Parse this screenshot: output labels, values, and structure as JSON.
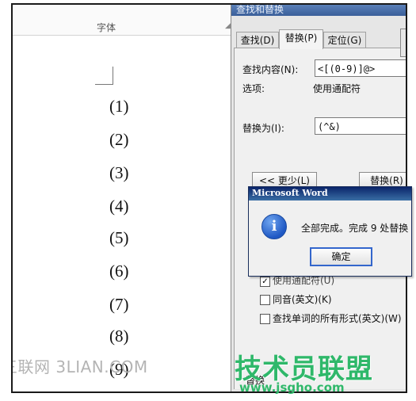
{
  "ribbon": {
    "font_group_label": "字体",
    "launcher_icon": "dialog-launcher-icon"
  },
  "document": {
    "numbers": [
      "(1)",
      "(2)",
      "(3)",
      "(4)",
      "(5)",
      "(6)",
      "(7)",
      "(8)",
      "(9)"
    ]
  },
  "watermark_left": "三联网 3LIAN.COM",
  "find_replace": {
    "title": "查找和替换",
    "tabs": [
      {
        "label": "查找(D)"
      },
      {
        "label": "替换(P)",
        "active": true
      },
      {
        "label": "定位(G)"
      }
    ],
    "find_label": "查找内容(N):",
    "find_value": "<[(0-9)]@>",
    "options_label": "选项:",
    "options_value": "使用通配符",
    "replace_label": "替换为(I):",
    "replace_value": "(^&)",
    "less_button": "<< 更少(L)",
    "replace_button": "替换(R)",
    "search_options_partial": "搜",
    "checkboxes": [
      {
        "label": "使用通配符(U)",
        "checked": true
      },
      {
        "label": "同音(英文)(K)",
        "checked": false
      },
      {
        "label": "查找单词的所有形式(英文)(W)",
        "checked": false
      }
    ],
    "bottom_partial": "替换"
  },
  "message_box": {
    "title": "Microsoft Word",
    "message": "全部完成。完成 9 处替换",
    "ok_label": "确定",
    "icon": "info-icon"
  },
  "logo": {
    "text": "技术员联盟",
    "url": "www.jsgho.com"
  },
  "colors": {
    "logo_green": "#2fb86a",
    "title_blue": "#0a246a"
  }
}
